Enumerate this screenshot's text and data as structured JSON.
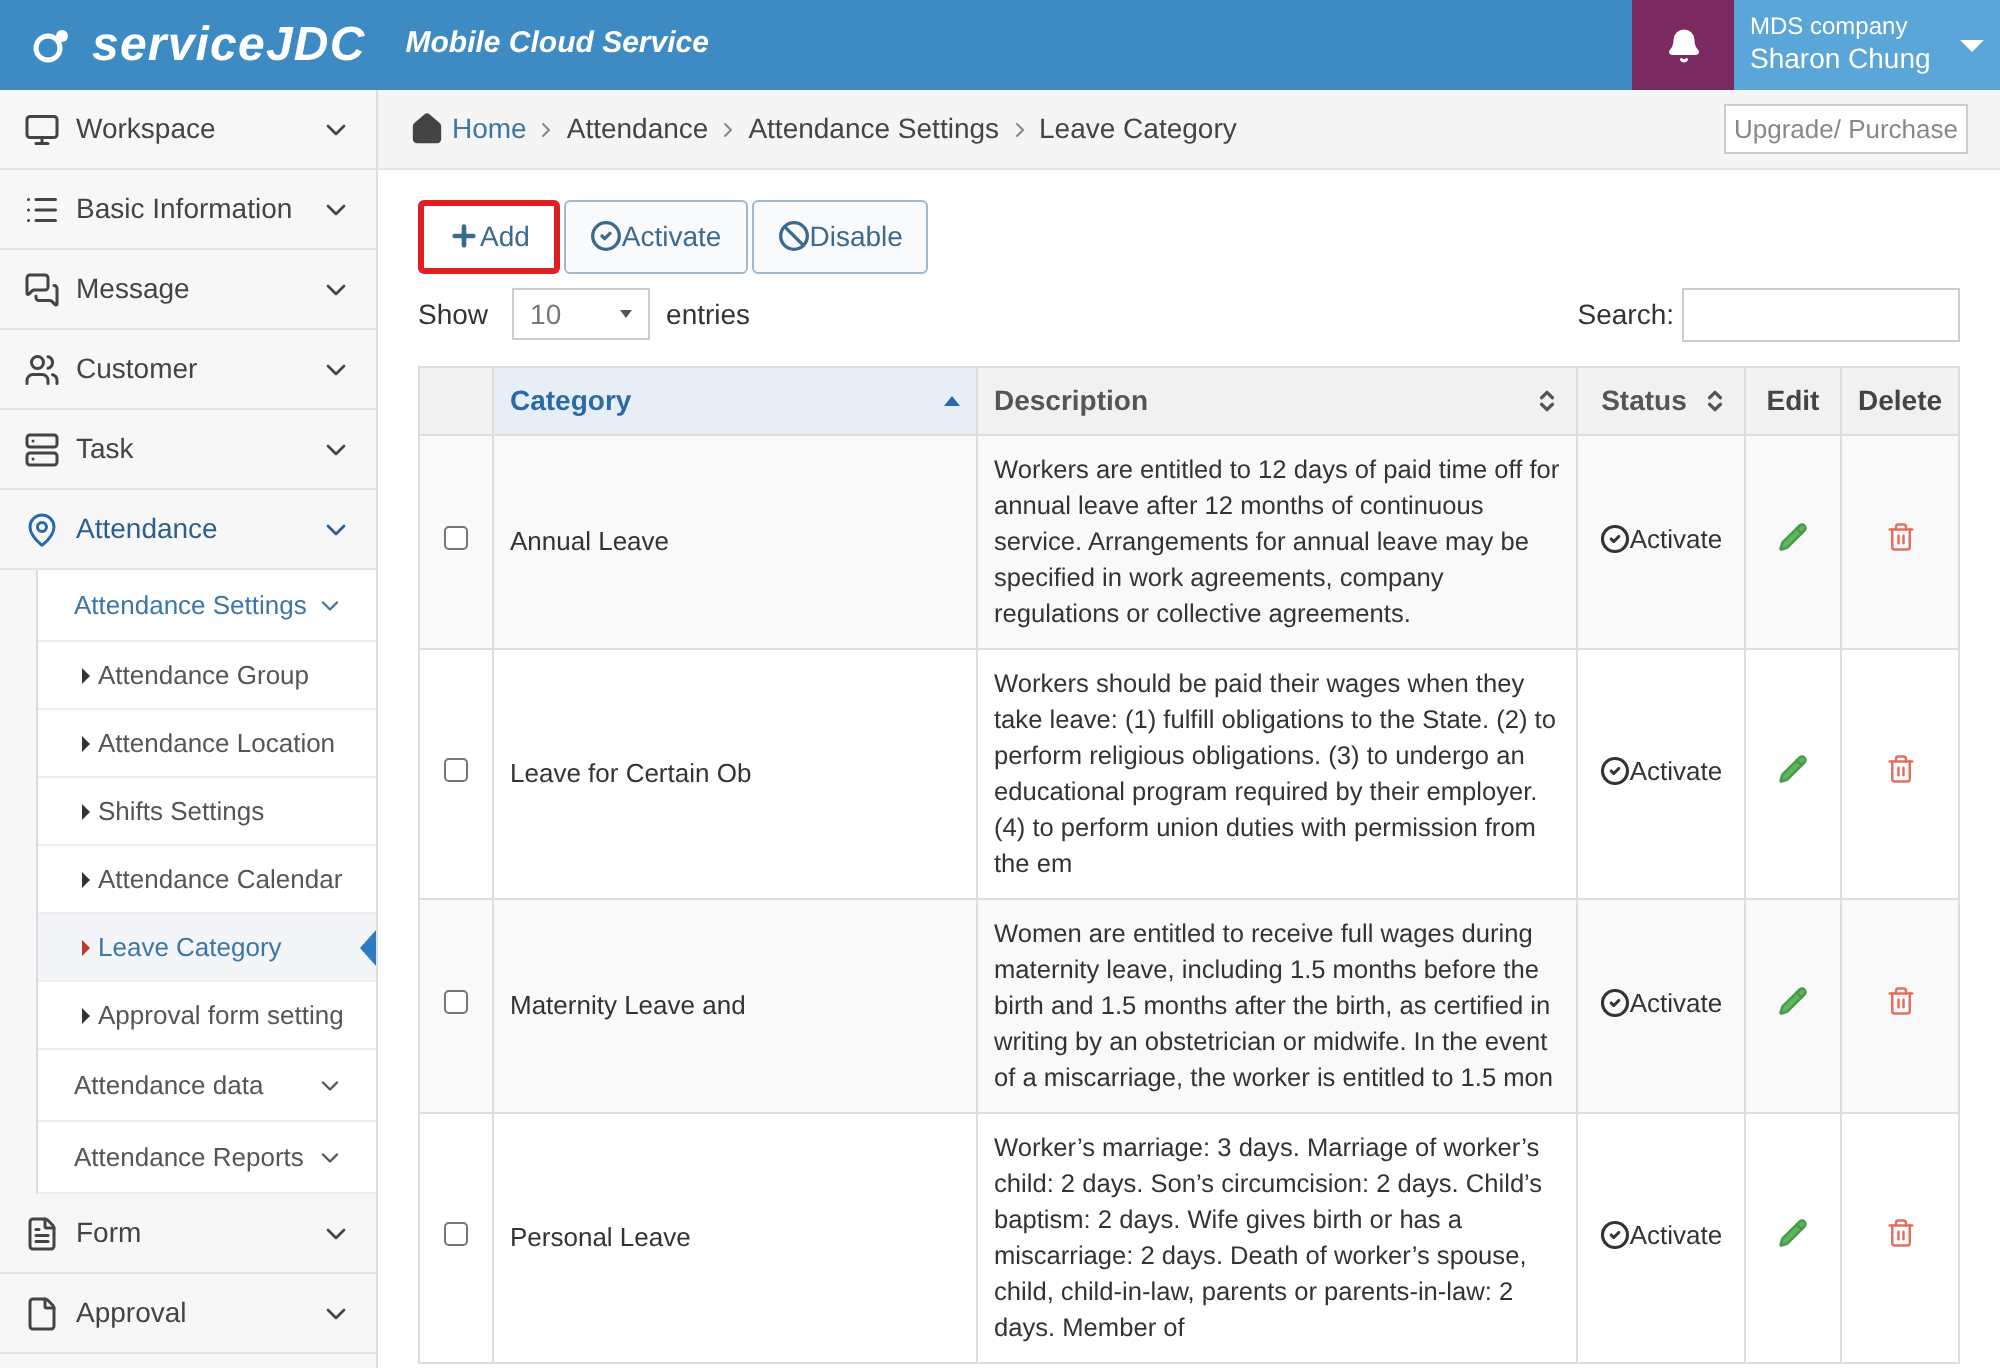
{
  "header": {
    "logo": "serviceJDC",
    "tagline": "Mobile Cloud Service",
    "company": "MDS company",
    "user": "Sharon Chung"
  },
  "sidebar": {
    "items": [
      {
        "label": "Workspace",
        "selected": false
      },
      {
        "label": "Basic Information",
        "selected": false
      },
      {
        "label": "Message",
        "selected": false
      },
      {
        "label": "Customer",
        "selected": false
      },
      {
        "label": "Task",
        "selected": false
      },
      {
        "label": "Attendance",
        "selected": true,
        "children": [
          {
            "label": "Attendance Settings",
            "selected": true,
            "children": [
              {
                "label": "Attendance Group",
                "selected": false
              },
              {
                "label": "Attendance Location",
                "selected": false
              },
              {
                "label": "Shifts Settings",
                "selected": false
              },
              {
                "label": "Attendance Calendar",
                "selected": false
              },
              {
                "label": "Leave Category",
                "selected": true
              },
              {
                "label": "Approval form setting",
                "selected": false
              }
            ]
          },
          {
            "label": "Attendance data",
            "selected": false
          },
          {
            "label": "Attendance Reports",
            "selected": false
          }
        ]
      },
      {
        "label": "Form",
        "selected": false
      },
      {
        "label": "Approval",
        "selected": false
      }
    ]
  },
  "breadcrumb": [
    "Home",
    "Attendance",
    "Attendance Settings",
    "Leave Category"
  ],
  "upgrade_button": "Upgrade/ Purchase",
  "actions": [
    {
      "label": "Add",
      "kind": "add",
      "highlighted": true
    },
    {
      "label": "Activate",
      "kind": "activate",
      "highlighted": false
    },
    {
      "label": "Disable",
      "kind": "disable",
      "highlighted": false
    }
  ],
  "show_label": "Show",
  "page_size": "10",
  "entries_label": "entries",
  "search_label": "Search:",
  "table": {
    "columns": [
      {
        "label": "Category",
        "sortable": true,
        "sorted": true
      },
      {
        "label": "Description",
        "sortable": true,
        "sorted": false
      },
      {
        "label": "Status",
        "sortable": true,
        "sorted": false
      },
      {
        "label": "Edit",
        "sortable": false,
        "sorted": false
      },
      {
        "label": "Delete",
        "sortable": false,
        "sorted": false
      }
    ],
    "rows": [
      {
        "checked": false,
        "category": "Annual Leave",
        "description": "Workers are entitled to 12 days of paid time off for annual leave after 12 months of continuous service. Arrangements for annual leave may be specified in work agreements, company regulations or collective agreements.",
        "status": "Activate"
      },
      {
        "checked": false,
        "category": "Leave for Certain Ob",
        "description": "Workers should be paid their wages when they take leave: (1) fulfill obligations to the State. (2) to perform religious obligations. (3) to undergo an educational program required by their employer. (4) to perform union duties with permission from the em",
        "status": "Activate"
      },
      {
        "checked": false,
        "category": "Maternity Leave and",
        "description": "Women are entitled to receive full wages during maternity leave, including 1.5 months before the birth and 1.5 months after the birth, as certified in writing by an obstetrician or midwife. In the event of a miscarriage, the worker is entitled to 1.5 mon",
        "status": "Activate"
      },
      {
        "checked": false,
        "category": "Personal Leave",
        "description": "Worker’s marriage: 3 days. Marriage of worker’s child: 2 days. Son’s circumcision: 2 days. Child’s baptism: 2 days. Wife gives birth or has a miscarriage: 2 days. Death of worker’s spouse, child, child-in-law, parents or parents-in-law: 2 days. Member of",
        "status": "Activate"
      }
    ]
  }
}
